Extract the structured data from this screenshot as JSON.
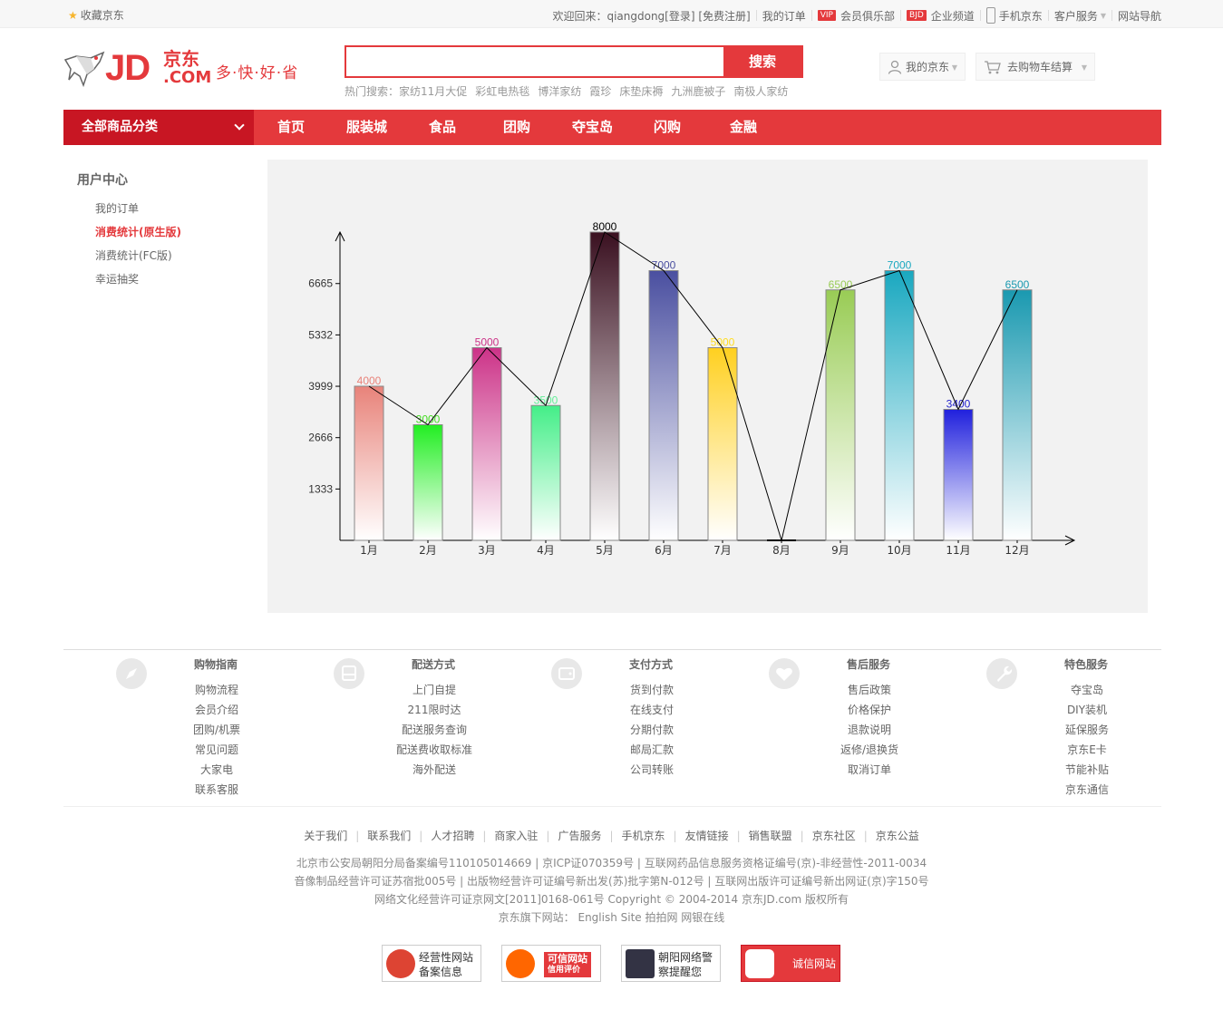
{
  "topbar": {
    "favorite": "收藏京东",
    "welcome": "欢迎回来：qiangdong[登录] [免费注册]",
    "my_orders": "我的订单",
    "vip_badge": "VIP",
    "vip_club": "会员俱乐部",
    "bjd_badge": "BJD",
    "enterprise": "企业频道",
    "mobile": "手机京东",
    "customer_service": "客户服务",
    "site_nav": "网站导航"
  },
  "header": {
    "logo_jd": "JD",
    "logo_cn": "京东",
    "logo_com": ".COM",
    "slogan": "多·快·好·省",
    "search_value": "",
    "search_button": "搜索",
    "hot_label": "热门搜索：",
    "hot_words": [
      "家纺11月大促",
      "彩虹电热毯",
      "博洋家纺",
      "霞珍",
      "床垫床褥",
      "九洲鹿被子",
      "南极人家纺"
    ],
    "my_jd": "我的京东",
    "cart": "去购物车结算"
  },
  "nav": {
    "all_categories": "全部商品分类",
    "items": [
      "首页",
      "服装城",
      "食品",
      "团购",
      "夺宝岛",
      "闪购",
      "金融"
    ]
  },
  "sidebar": {
    "title": "用户中心",
    "items": [
      "我的订单",
      "消费统计(原生版)",
      "消费统计(FC版)",
      "幸运抽奖"
    ]
  },
  "chart_data": {
    "type": "bar",
    "categories": [
      "1月",
      "2月",
      "3月",
      "4月",
      "5月",
      "6月",
      "7月",
      "8月",
      "9月",
      "10月",
      "11月",
      "12月"
    ],
    "values": [
      4000,
      3000,
      5000,
      3500,
      8000,
      7000,
      5000,
      0,
      6500,
      7000,
      3400,
      6500
    ],
    "data_labels": [
      "4000",
      "3000",
      "5000",
      "3500",
      "8000",
      "7000",
      "5000",
      "",
      "6500",
      "7000",
      "3400",
      "6500"
    ],
    "yticks": [
      1333,
      2666,
      3999,
      5332,
      6665
    ],
    "ylim": [
      0,
      8000
    ],
    "overlay_line": true,
    "grid": false,
    "colors": [
      "#e8837a",
      "#22ee22",
      "#cc3388",
      "#44ee88",
      "#3a1020",
      "#4a4fa0",
      "#ffd020",
      "#000000",
      "#99cc55",
      "#1aa8c0",
      "#2020dd",
      "#1a99b0"
    ],
    "label_colors": [
      "#e8837a",
      "#44dd22",
      "#cc3388",
      "#66ee99",
      "#000000",
      "#4a4fa0",
      "#ffdd22",
      "#000000",
      "#99cc55",
      "#1aa8c0",
      "#2222cc",
      "#1a99b0"
    ]
  },
  "footer": {
    "columns": [
      {
        "title": "购物指南",
        "icon": "compass-icon",
        "links": [
          "购物流程",
          "会员介绍",
          "团购/机票",
          "常见问题",
          "大家电",
          "联系客服"
        ]
      },
      {
        "title": "配送方式",
        "icon": "bus-icon",
        "links": [
          "上门自提",
          "211限时达",
          "配送服务查询",
          "配送费收取标准",
          "海外配送"
        ]
      },
      {
        "title": "支付方式",
        "icon": "wallet-icon",
        "links": [
          "货到付款",
          "在线支付",
          "分期付款",
          "邮局汇款",
          "公司转账"
        ]
      },
      {
        "title": "售后服务",
        "icon": "heart-icon",
        "links": [
          "售后政策",
          "价格保护",
          "退款说明",
          "返修/退换货",
          "取消订单"
        ]
      },
      {
        "title": "特色服务",
        "icon": "wrench-icon",
        "links": [
          "夺宝岛",
          "DIY装机",
          "延保服务",
          "京东E卡",
          "节能补贴",
          "京东通信"
        ]
      }
    ],
    "bottom_links": [
      "关于我们",
      "联系我们",
      "人才招聘",
      "商家入驻",
      "广告服务",
      "手机京东",
      "友情链接",
      "销售联盟",
      "京东社区",
      "京东公益"
    ],
    "copy_lines": [
      "北京市公安局朝阳分局备案编号110105014669 | 京ICP证070359号 | 互联网药品信息服务资格证编号(京)-非经营性-2011-0034",
      "音像制品经营许可证苏宿批005号 | 出版物经营许可证编号新出发(苏)批字第N-012号 | 互联网出版许可证编号新出网证(京)字150号",
      "网络文化经营许可证京网文[2011]0168-061号 Copyright © 2004-2014 京东JD.com 版权所有",
      "京东旗下网站： English Site 拍拍网 网银在线"
    ],
    "certs": [
      {
        "line1": "经营性网站",
        "line2": "备案信息"
      },
      {
        "line1": "可信网站",
        "line2": "信用评价"
      },
      {
        "line1": "朝阳网络警",
        "line2": "察提醒您"
      },
      {
        "line1": "诚信网站",
        "line2": ""
      }
    ]
  }
}
